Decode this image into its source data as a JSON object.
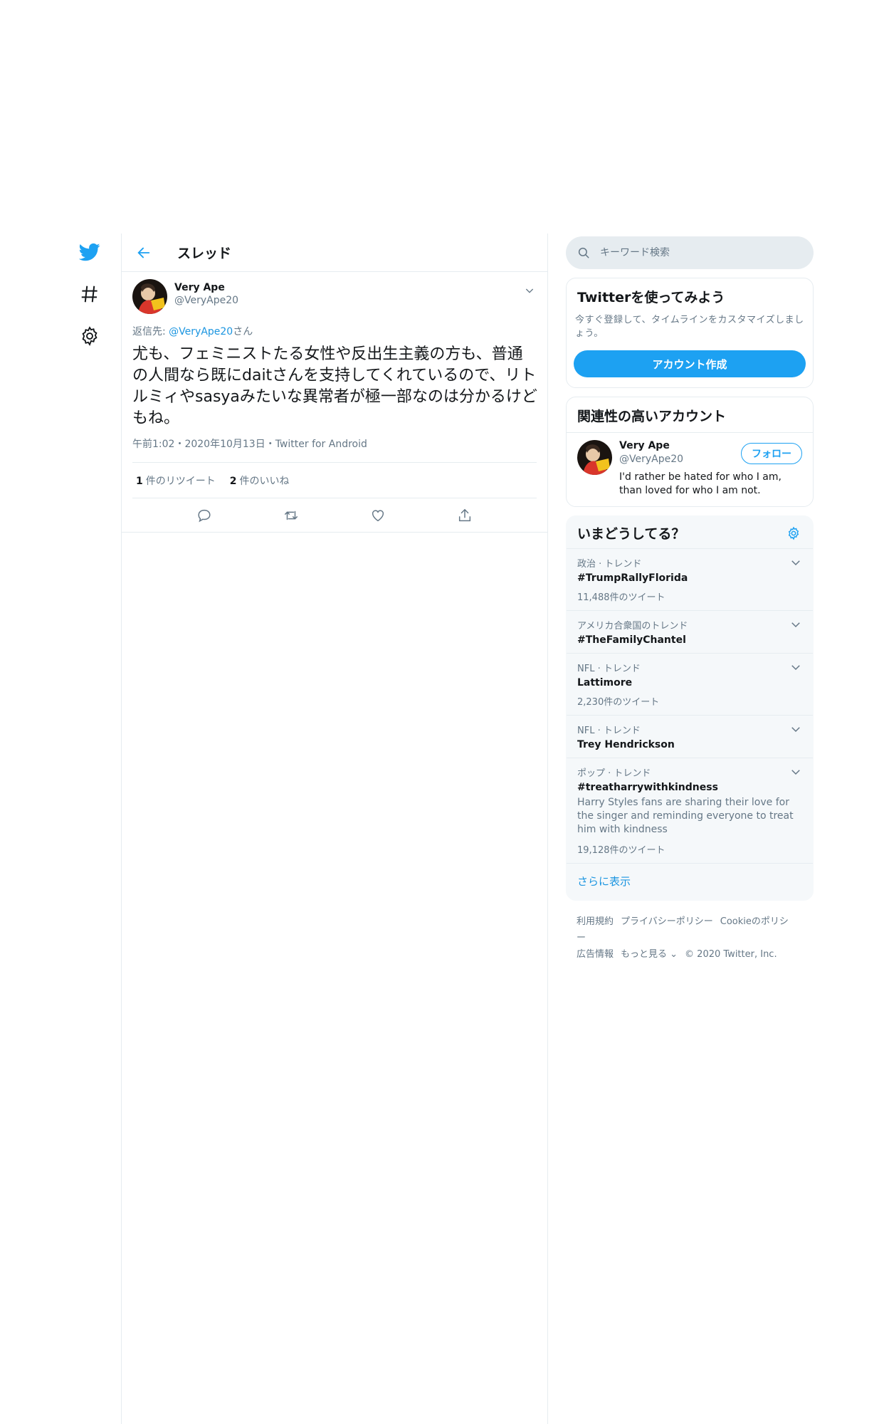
{
  "nav": {
    "items": [
      {
        "icon": "twitter-bird-icon"
      },
      {
        "icon": "hashtag-icon"
      },
      {
        "icon": "gear-icon"
      }
    ]
  },
  "header": {
    "title": "スレッド"
  },
  "tweet": {
    "user_name": "Very Ape",
    "user_handle": "@VeryApe20",
    "reply_prefix": "返信先: ",
    "reply_mention": "@VeryApe20",
    "reply_suffix": "さん",
    "text": "尤も、フェミニストたる女性や反出生主義の方も、普通の人間なら既にdaitさんを支持してくれているので、リトルミィやsasyaみたいな異常者が極一部なのは分かるけどもね。",
    "meta": "午前1:02・2020年10月13日・Twitter for Android",
    "retweet_count": "1",
    "retweet_label": "件のリツイート",
    "like_count": "2",
    "like_label": "件のいいね"
  },
  "search": {
    "placeholder": "キーワード検索"
  },
  "signup": {
    "title": "Twitterを使ってみよう",
    "desc": "今すぐ登録して、タイムラインをカスタマイズしましょう。",
    "button": "アカウント作成"
  },
  "related": {
    "title": "関連性の高いアカウント",
    "name": "Very Ape",
    "handle": "@VeryApe20",
    "bio": "I'd rather be hated for who I am, than loved for who I am not.",
    "follow": "フォロー"
  },
  "trends": {
    "title": "いまどうしてる？",
    "items": [
      {
        "category": "政治 · トレンド",
        "name": "#TrumpRallyFlorida",
        "desc": "",
        "count": "11,488件のツイート"
      },
      {
        "category": "アメリカ合衆国のトレンド",
        "name": "#TheFamilyChantel",
        "desc": "",
        "count": ""
      },
      {
        "category": "NFL · トレンド",
        "name": "Lattimore",
        "desc": "",
        "count": "2,230件のツイート"
      },
      {
        "category": "NFL · トレンド",
        "name": "Trey Hendrickson",
        "desc": "",
        "count": ""
      },
      {
        "category": "ポップ · トレンド",
        "name": "#treatharrywithkindness",
        "desc": "Harry Styles fans are sharing their love for the singer and reminding everyone to treat him with kindness",
        "count": "19,128件のツイート"
      }
    ],
    "show_more": "さらに表示"
  },
  "footer": {
    "links": [
      "利用規約",
      "プライバシーポリシー",
      "Cookieのポリシー",
      "広告情報",
      "もっと見る ⌄",
      "© 2020 Twitter, Inc."
    ]
  },
  "colors": {
    "accent": "#1da1f2",
    "link": "#1b95e0",
    "border": "#e6ecf0",
    "muted": "#657786",
    "panel": "#f5f8fa"
  }
}
